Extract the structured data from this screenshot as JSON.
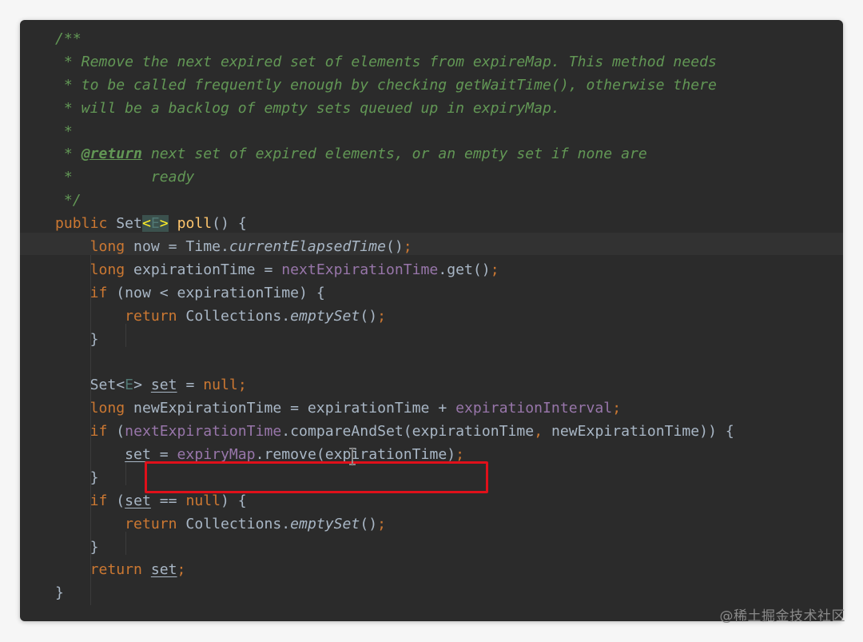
{
  "code": {
    "doc_open": "/**",
    "doc_line_1": " * Remove the next expired set of elements from expireMap. This method needs",
    "doc_line_2": " * to be called frequently enough by checking getWaitTime(), otherwise there",
    "doc_line_3": " * will be a backlog of empty sets queued up in expiryMap.",
    "doc_line_4": " *",
    "doc_return_prefix": " * ",
    "doc_return_tag": "@return",
    "doc_return_text": " next set of expired elements, or an empty set if none are",
    "doc_line_6": " *         ready",
    "doc_close": " */",
    "sig_public": "public",
    "sig_set": " Set",
    "sig_lt": "<",
    "sig_e": "E",
    "sig_gt": ">",
    "sig_sp": " ",
    "sig_poll": "poll",
    "sig_rest": "() {",
    "l_now_kw": "long",
    "l_now_a": " now = Time.",
    "l_now_fn": "currentElapsedTime",
    "l_now_b": "()",
    "semi": ";",
    "l_exp_kw": "long",
    "l_exp_a": " expirationTime = ",
    "l_exp_fld": "nextExpirationTime",
    "l_exp_b": ".get()",
    "l_if1_kw": "if",
    "l_if1_a": " (now < expirationTime) {",
    "l_ret1_kw": "return",
    "l_ret1_a": " Collections.",
    "l_ret1_fn": "emptySet",
    "l_ret1_b": "()",
    "close_brace": "}",
    "l_set_a": "Set<",
    "l_set_e": "E",
    "l_set_b": "> ",
    "l_set_var": "set",
    "l_set_c": " = ",
    "l_set_null": "null",
    "l_nexp_kw": "long",
    "l_nexp_a": " newExpirationTime = expirationTime + ",
    "l_nexp_fld": "expirationInterval",
    "l_if2_kw": "if",
    "l_if2_a": " (",
    "l_if2_fld": "nextExpirationTime",
    "l_if2_b": ".compareAndSet(expirationTime",
    "comma": ",",
    "l_if2_c": " newExpirationTime)) {",
    "l_asg_var": "set",
    "l_asg_a": " = ",
    "l_asg_fld": "expiryMap",
    "l_asg_b": ".remove(expirationTime)",
    "l_if3_kw": "if",
    "l_if3_a": " (",
    "l_if3_var": "set",
    "l_if3_b": " == ",
    "l_if3_null": "null",
    "l_if3_c": ") {",
    "l_ret2_kw": "return",
    "l_ret2_a": " Collections.",
    "l_ret2_fn": "emptySet",
    "l_ret2_b": "()",
    "l_ret3_kw": "return",
    "l_ret3_sp": " ",
    "l_ret3_var": "set",
    "method_close": "}"
  },
  "watermark": "@稀土掘金技术社区",
  "colors": {
    "background": "#2b2b2b",
    "keyword": "#cc7832",
    "comment": "#629755",
    "method": "#ffc66d",
    "field": "#9876aa",
    "highlight_box": "#e0101a"
  }
}
